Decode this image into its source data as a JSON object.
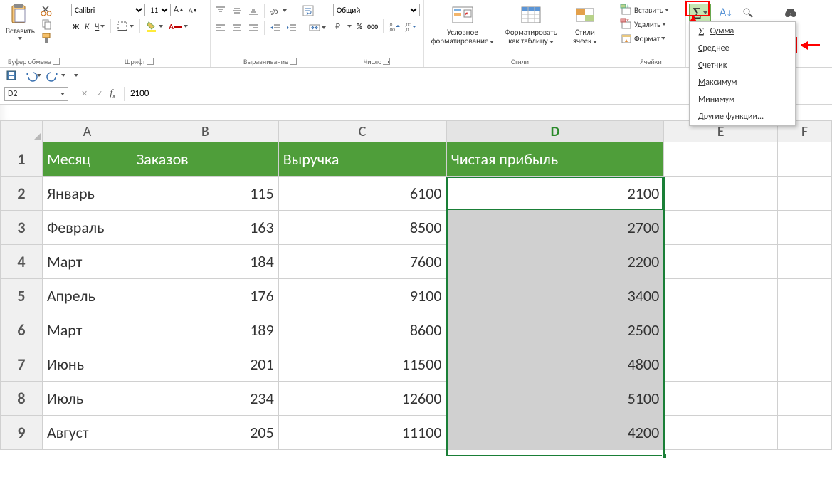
{
  "ribbon": {
    "clipboard": {
      "label": "Буфер обмена",
      "paste": "Вставить"
    },
    "font": {
      "label": "Шрифт",
      "name": "Calibri",
      "size": "11"
    },
    "alignment": {
      "label": "Выравнивание"
    },
    "number": {
      "label": "Число",
      "format": "Общий"
    },
    "styles": {
      "label": "Стили",
      "conditional": "Условное\nформатирование",
      "asTable": "Форматировать\nкак таблицу",
      "cellStyles": "Стили\nячеек"
    },
    "cells": {
      "label": "Ячейки",
      "insert": "Вставить",
      "delete": "Удалить",
      "format": "Формат"
    }
  },
  "autosum_menu": {
    "sum": "Сумма",
    "avg": "Среднее",
    "count": "Счетчик",
    "max": "Максимум",
    "min": "Минимум",
    "more": "Другие функции..."
  },
  "namebox": "D2",
  "formula_value": "2100",
  "columns": [
    "A",
    "B",
    "C",
    "D",
    "E",
    "F"
  ],
  "rows": [
    "1",
    "2",
    "3",
    "4",
    "5",
    "6",
    "7",
    "8",
    "9"
  ],
  "headers": {
    "A": "Месяц",
    "B": "Заказов",
    "C": "Выручка",
    "D": "Чистая прибыль"
  },
  "data": [
    {
      "A": "Январь",
      "B": "115",
      "C": "6100",
      "D": "2100"
    },
    {
      "A": "Февраль",
      "B": "163",
      "C": "8500",
      "D": "2700"
    },
    {
      "A": "Март",
      "B": "184",
      "C": "7600",
      "D": "2200"
    },
    {
      "A": "Апрель",
      "B": "176",
      "C": "9100",
      "D": "3400"
    },
    {
      "A": "Март",
      "B": "189",
      "C": "8600",
      "D": "2500"
    },
    {
      "A": "Июнь",
      "B": "201",
      "C": "11500",
      "D": "4800"
    },
    {
      "A": "Июль",
      "B": "234",
      "C": "12600",
      "D": "5100"
    },
    {
      "A": "Август",
      "B": "205",
      "C": "11100",
      "D": "4200"
    }
  ],
  "chart_data": {
    "type": "table",
    "title": "",
    "columns": [
      "Месяц",
      "Заказов",
      "Выручка",
      "Чистая прибыль"
    ],
    "rows": [
      [
        "Январь",
        115,
        6100,
        2100
      ],
      [
        "Февраль",
        163,
        8500,
        2700
      ],
      [
        "Март",
        184,
        7600,
        2200
      ],
      [
        "Апрель",
        176,
        9100,
        3400
      ],
      [
        "Март",
        189,
        8600,
        2500
      ],
      [
        "Июнь",
        201,
        11500,
        4800
      ],
      [
        "Июль",
        234,
        12600,
        5100
      ],
      [
        "Август",
        205,
        11100,
        4200
      ]
    ]
  }
}
